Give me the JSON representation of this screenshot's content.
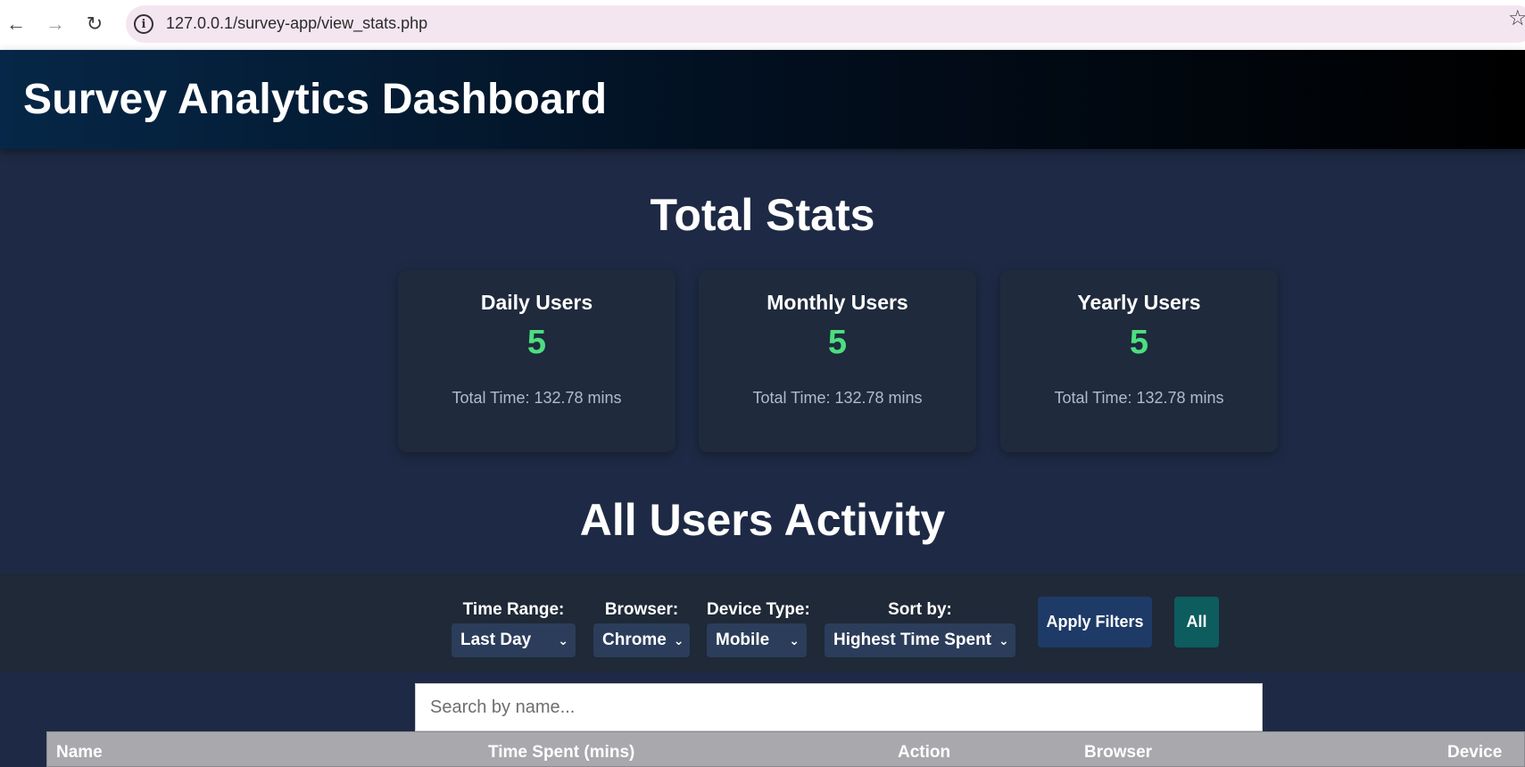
{
  "browser": {
    "url": "127.0.0.1/survey-app/view_stats.php",
    "back_icon": "←",
    "forward_icon": "→",
    "reload_icon": "↻",
    "info_icon": "i",
    "star_icon": "☆"
  },
  "header": {
    "title": "Survey Analytics Dashboard"
  },
  "total_stats": {
    "title": "Total Stats",
    "cards": [
      {
        "label": "Daily Users",
        "value": "5",
        "time": "Total Time: 132.78 mins"
      },
      {
        "label": "Monthly Users",
        "value": "5",
        "time": "Total Time: 132.78 mins"
      },
      {
        "label": "Yearly Users",
        "value": "5",
        "time": "Total Time: 132.78 mins"
      }
    ],
    "value_color": "#4cde80"
  },
  "activity": {
    "title": "All Users Activity",
    "filters": {
      "time_range": {
        "label": "Time Range:",
        "selected": "Last Day"
      },
      "browser": {
        "label": "Browser:",
        "selected": "Chrome"
      },
      "device_type": {
        "label": "Device Type:",
        "selected": "Mobile"
      },
      "sort_by": {
        "label": "Sort by:",
        "selected": "Highest Time Spent"
      }
    },
    "apply_label": "Apply Filters",
    "all_label": "All",
    "search_placeholder": "Search by name...",
    "table": {
      "columns": [
        "Name",
        "Time Spent (mins)",
        "Action",
        "Browser",
        "Device"
      ]
    }
  },
  "colors": {
    "page_bg": "#1e2a45",
    "card_bg": "#1f2a3c",
    "apply_button": "#1e3a66",
    "all_button": "#0d5c5e"
  }
}
